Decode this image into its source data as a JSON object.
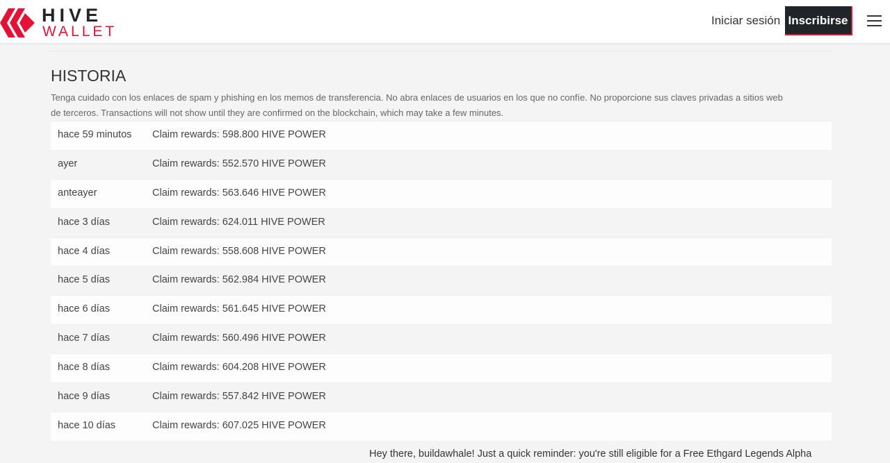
{
  "header": {
    "logo_top": "HIVE",
    "logo_bottom": "WALLET",
    "login_label": "Iniciar sesión",
    "signup_label": "Inscribirse",
    "menu_icon": "hamburger-icon",
    "brand_color": "#e31337"
  },
  "history": {
    "title": "HISTORIA",
    "warning": "Tenga cuidado con los enlaces de spam y phishing en los memos de transferencia. No abra enlaces de usuarios en los que no confíe. No proporcione sus claves privadas a sitios web de terceros. Transactions will not show until they are confirmed on the blockchain, which may take a few minutes.",
    "rows": [
      {
        "time": "hace 59 minutos",
        "op": "Claim rewards: 598.800 HIVE POWER"
      },
      {
        "time": "ayer",
        "op": "Claim rewards: 552.570 HIVE POWER"
      },
      {
        "time": "anteayer",
        "op": "Claim rewards: 563.646 HIVE POWER"
      },
      {
        "time": "hace 3 días",
        "op": "Claim rewards: 624.011 HIVE POWER"
      },
      {
        "time": "hace 4 días",
        "op": "Claim rewards: 558.608 HIVE POWER"
      },
      {
        "time": "hace 5 días",
        "op": "Claim rewards: 562.984 HIVE POWER"
      },
      {
        "time": "hace 6 días",
        "op": "Claim rewards: 561.645 HIVE POWER"
      },
      {
        "time": "hace 7 días",
        "op": "Claim rewards: 560.496 HIVE POWER"
      },
      {
        "time": "hace 8 días",
        "op": "Claim rewards: 604.208 HIVE POWER"
      },
      {
        "time": "hace 9 días",
        "op": "Claim rewards: 557.842 HIVE POWER"
      },
      {
        "time": "hace 10 días",
        "op": "Claim rewards: 607.025 HIVE POWER"
      }
    ],
    "memo": "Hey there, buildawhale! Just a quick reminder: you're still eligible for a Free Ethgard Legends Alpha"
  }
}
